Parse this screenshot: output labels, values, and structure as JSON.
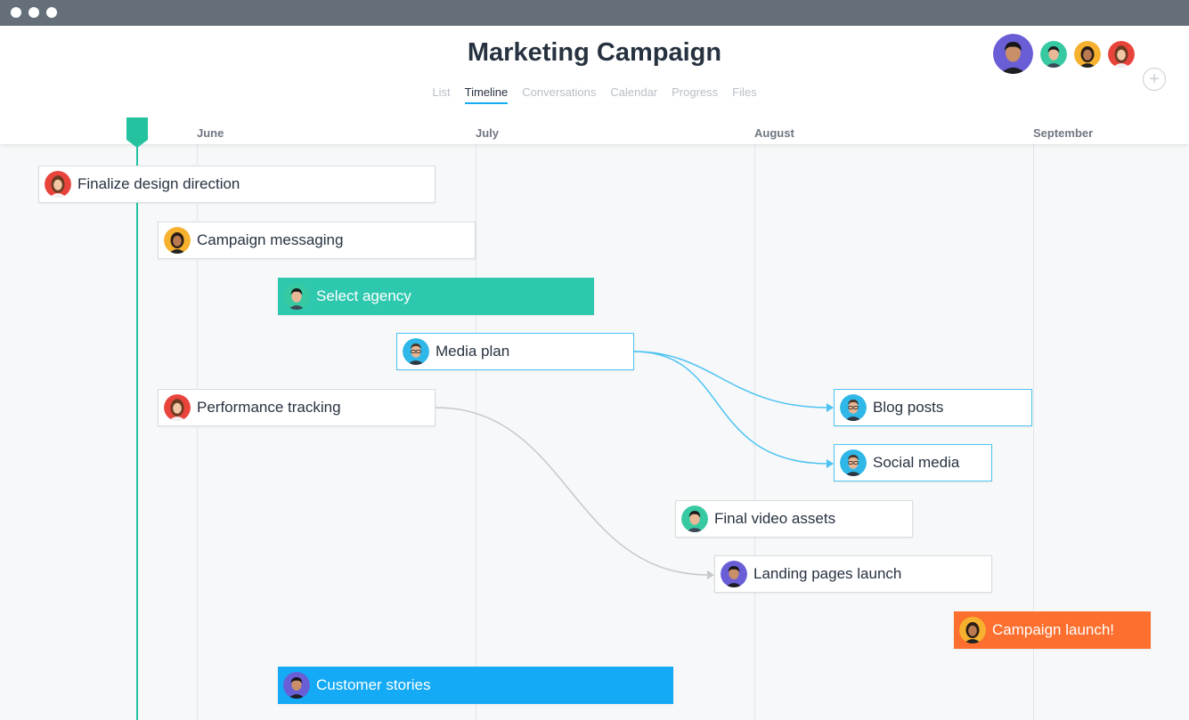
{
  "project": {
    "title": "Marketing Campaign",
    "add_member_label": "+"
  },
  "tabs": [
    "List",
    "Timeline",
    "Conversations",
    "Calendar",
    "Progress",
    "Files"
  ],
  "active_tab": "Timeline",
  "months": [
    "June",
    "July",
    "August",
    "September"
  ],
  "tasks": [
    {
      "label": "Finalize design direction"
    },
    {
      "label": "Campaign messaging"
    },
    {
      "label": "Select agency"
    },
    {
      "label": "Media plan"
    },
    {
      "label": "Performance tracking"
    },
    {
      "label": "Blog posts"
    },
    {
      "label": "Social media"
    },
    {
      "label": "Final video assets"
    },
    {
      "label": "Landing pages launch"
    },
    {
      "label": "Campaign launch!"
    },
    {
      "label": "Customer stories"
    }
  ],
  "colors": {
    "today": "#25c2a0",
    "teal_task": "#2ec8af",
    "orange_task": "#fc6f2e",
    "blue_task": "#14aaf5",
    "dependency_blue": "#4dc3f3",
    "dependency_gray": "#c4c9ce"
  }
}
